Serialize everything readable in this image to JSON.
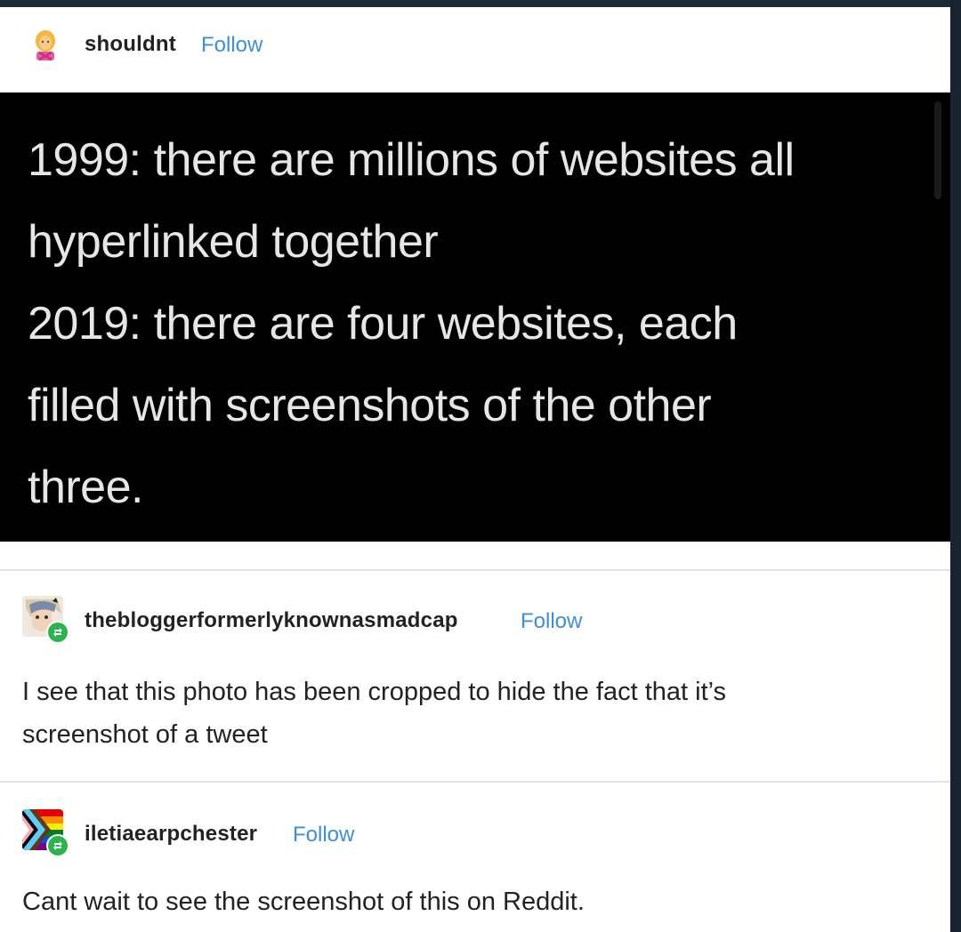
{
  "post": {
    "author": "shouldnt",
    "follow_label": "Follow",
    "tweet_lines": "1999: there are millions of websites all\nhyperlinked together\n2019: there are four websites, each\nfilled with screenshots of the other\nthree."
  },
  "comments": [
    {
      "author": "thebloggerformerlyknownasmadcap",
      "follow_label": "Follow",
      "text_line1": "I see that this photo has been cropped to hide the fact that it’s",
      "text_line2": "screenshot of a tweet",
      "avatar_icon": "anime-character-avatar",
      "badge_icon": "reblog-icon"
    },
    {
      "author": "iletiaearpchester",
      "follow_label": "Follow",
      "text_line1": "Cant wait to see the screenshot of this on Reddit.",
      "avatar_icon": "progress-pride-flag-avatar",
      "badge_icon": "reblog-icon"
    }
  ],
  "colors": {
    "follow": "#3d8fd9",
    "background": "#1b2a39",
    "badge": "#2bb34d"
  }
}
